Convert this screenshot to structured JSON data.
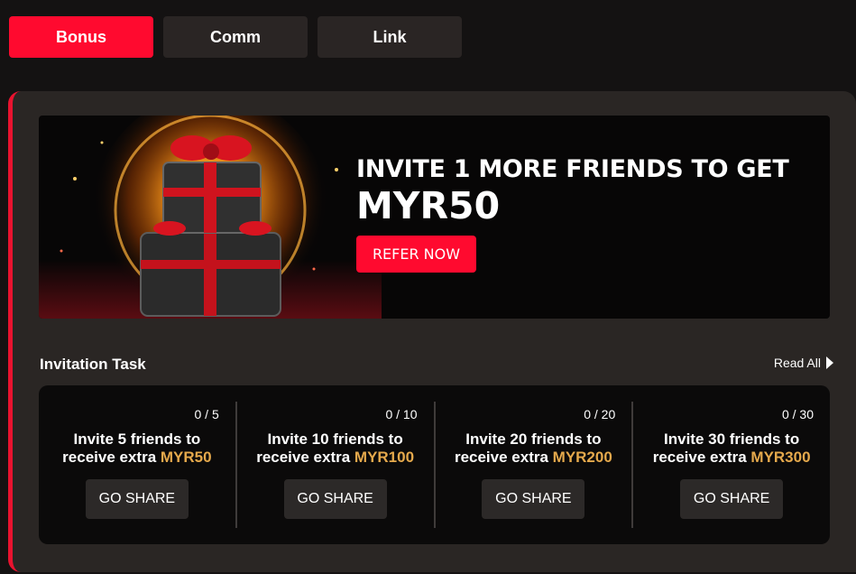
{
  "tabs": [
    {
      "label": "Bonus",
      "active": true
    },
    {
      "label": "Comm",
      "active": false
    },
    {
      "label": "Link",
      "active": false
    }
  ],
  "banner": {
    "title": "INVITE 1 MORE FRIENDS TO GET",
    "amount": "MYR50",
    "button": "REFER NOW"
  },
  "section": {
    "title": "Invitation Task",
    "read_all": "Read All"
  },
  "tasks": [
    {
      "progress": "0 / 5",
      "line1": "Invite 5 friends to",
      "line2_prefix": "receive extra ",
      "amount": "MYR50",
      "button": "GO SHARE"
    },
    {
      "progress": "0 / 10",
      "line1": "Invite 10 friends to",
      "line2_prefix": "receive extra ",
      "amount": "MYR100",
      "button": "GO SHARE"
    },
    {
      "progress": "0 / 20",
      "line1": "Invite 20 friends to",
      "line2_prefix": "receive extra ",
      "amount": "MYR200",
      "button": "GO SHARE"
    },
    {
      "progress": "0 / 30",
      "line1": "Invite 30 friends to",
      "line2_prefix": "receive extra ",
      "amount": "MYR300",
      "button": "GO SHARE"
    }
  ],
  "colors": {
    "accent": "#ff0a2f",
    "gold": "#e5a94c",
    "panel": "#2a2624"
  }
}
